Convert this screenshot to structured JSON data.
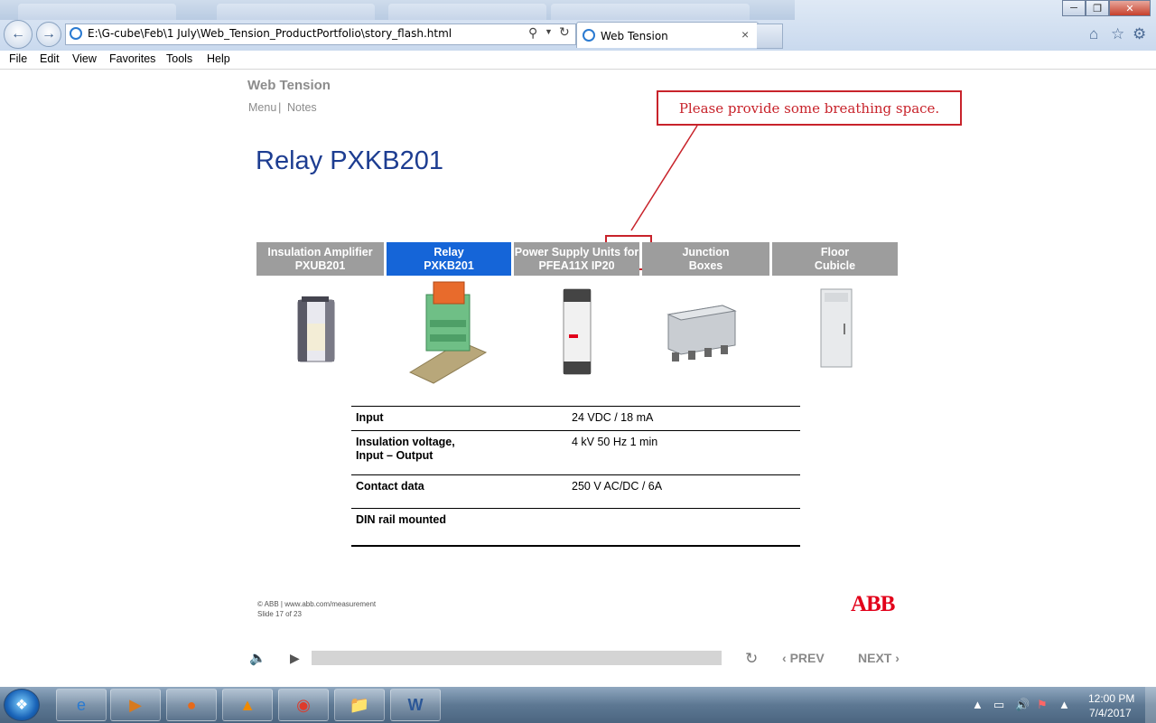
{
  "browser": {
    "address": "E:\\G-cube\\Feb\\1 July\\Web_Tension_ProductPortfolio\\story_flash.html",
    "tab_title": "Web Tension",
    "tab_close": "×",
    "menu": [
      "File",
      "Edit",
      "View",
      "Favorites",
      "Tools",
      "Help"
    ]
  },
  "course": {
    "title": "Web Tension",
    "menu_link": "Menu",
    "separator": "|",
    "notes_link": "Notes"
  },
  "slide": {
    "title": "Relay PXKB201",
    "callout": "Please provide some breathing space.",
    "tabs": [
      {
        "line1": "Insulation Amplifier",
        "line2": "PXUB201",
        "selected": false
      },
      {
        "line1": "Relay",
        "line2": "PXKB201",
        "selected": true
      },
      {
        "line1": "Power Supply Units for",
        "line2": "PFEA11X IP20",
        "selected": false
      },
      {
        "line1": "Junction",
        "line2": "Boxes",
        "selected": false
      },
      {
        "line1": "Floor",
        "line2": "Cubicle",
        "selected": false
      }
    ],
    "specs": [
      {
        "label_line1": "Input",
        "label_line2": "",
        "value": "24 VDC / 18 mA"
      },
      {
        "label_line1": "Insulation voltage,",
        "label_line2": "Input – Output",
        "value": "4 kV 50 Hz 1 min"
      },
      {
        "label_line1": "Contact data",
        "label_line2": "",
        "value": "250 V AC/DC  /  6A"
      },
      {
        "label_line1": "DIN rail mounted",
        "label_line2": "",
        "value": ""
      }
    ],
    "footer_line1": "© ABB | www.abb.com/measurement",
    "footer_line2": "Slide 17 of 23",
    "logo": "ABB"
  },
  "player": {
    "prev_label": "PREV",
    "next_label": "NEXT",
    "prev_icon": "‹",
    "next_icon": "›",
    "progress": 0
  },
  "taskbar": {
    "time": "12:00 PM",
    "date": "7/4/2017"
  },
  "colors": {
    "selected_tab": "#1565d8",
    "tab": "#9d9d9d",
    "title_blue": "#1d3d91",
    "annotation_red": "#c8232b",
    "abb_red": "#e2001a"
  }
}
